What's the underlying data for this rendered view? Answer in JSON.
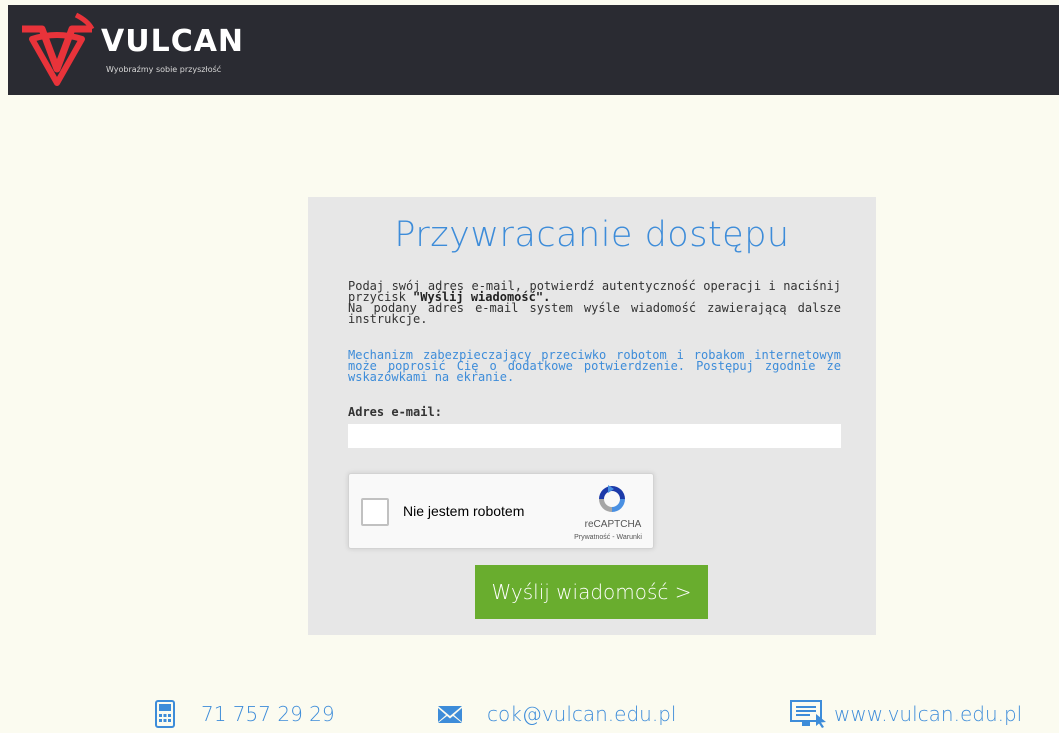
{
  "brand": {
    "name": "VULCAN",
    "tagline": "Wyobraźmy sobie przyszłość"
  },
  "form": {
    "title": "Przywracanie dostępu",
    "intro_text": "Podaj swój adres e-mail, potwierdź autentyczność operacji i naciśnij przycisk",
    "intro_button_ref": "\"Wyślij wiadomość\".",
    "intro_text_2": "Na podany adres e-mail system wyśle wiadomość zawierającą dalsze instrukcje.",
    "notice": "Mechanizm zabezpieczający przeciwko robotom i robakom internetowym może poprosić Cię o dodatkowe potwierdzenie. Postępuj zgodnie ze wskazówkami na ekranie.",
    "email_label": "Adres e-mail:",
    "email_value": "",
    "submit_label": "Wyślij wiadomość >"
  },
  "captcha": {
    "label": "Nie jestem robotem",
    "brand": "reCAPTCHA",
    "privacy": "Prywatność",
    "separator": " - ",
    "terms": "Warunki",
    "checked": false
  },
  "footer": {
    "phone": "71 757 29 29",
    "email": "cok@vulcan.edu.pl",
    "website": "www.vulcan.edu.pl"
  },
  "colors": {
    "header_bg": "#2a2b32",
    "accent_blue": "#3d8cd9",
    "logo_red": "#e8333a",
    "button_green": "#69ad2e",
    "card_bg": "#e7e7e7",
    "page_bg": "#fbfbf0"
  },
  "icons": {
    "logo": "vulcan-logo-icon",
    "phone": "phone-icon",
    "mail": "mail-icon",
    "web": "monitor-icon",
    "captcha": "recaptcha-icon"
  }
}
